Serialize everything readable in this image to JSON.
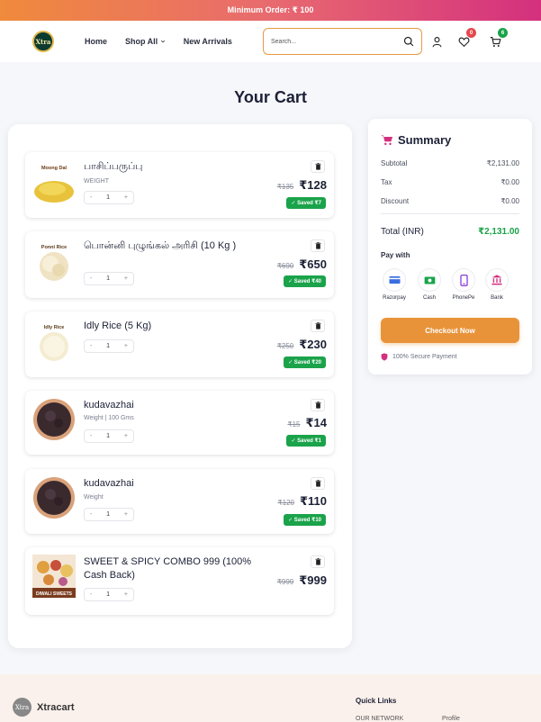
{
  "promo": {
    "text": "Minimum Order: ₹ 100"
  },
  "header": {
    "logo_text": "Xtra",
    "nav": [
      "Home",
      "Shop All",
      "New Arrivals"
    ],
    "search_placeholder": "Search...",
    "wishlist_count": "0",
    "cart_count": "6"
  },
  "page_title": "Your Cart",
  "cart": {
    "items": [
      {
        "name": "பாசிப்பருப்பு",
        "sub": "WEIGHT",
        "qty": "1",
        "old_price": "₹135",
        "price": "₹128",
        "saved": "Saved ₹7",
        "thumb_label": "Moong Dal"
      },
      {
        "name": "பொன்னி புழுங்கல் அரிசி (10 Kg )",
        "sub": "",
        "qty": "1",
        "old_price": "₹690",
        "price": "₹650",
        "saved": "Saved ₹40",
        "thumb_label": "Ponni Rice"
      },
      {
        "name": "Idly Rice (5 Kg)",
        "sub": "",
        "qty": "1",
        "old_price": "₹250",
        "price": "₹230",
        "saved": "Saved ₹20",
        "thumb_label": "Idly Rice"
      },
      {
        "name": "kudavazhai",
        "sub": "Weight | 100 Gms",
        "qty": "1",
        "old_price": "₹15",
        "price": "₹14",
        "saved": "Saved ₹1",
        "thumb_label": ""
      },
      {
        "name": "kudavazhai",
        "sub": "Weight",
        "qty": "1",
        "old_price": "₹120",
        "price": "₹110",
        "saved": "Saved ₹10",
        "thumb_label": ""
      },
      {
        "name": "SWEET & SPICY COMBO 999 (100% Cash Back)",
        "sub": "",
        "qty": "1",
        "old_price": "₹999",
        "price": "₹999",
        "saved": "",
        "thumb_label": "DIWALI SWEETS"
      }
    ],
    "qty_minus": "-",
    "qty_plus": "+"
  },
  "summary": {
    "title": "Summary",
    "subtotal_label": "Subtotal",
    "subtotal": "₹2,131.00",
    "tax_label": "Tax",
    "tax": "₹0.00",
    "discount_label": "Discount",
    "discount": "₹0.00",
    "total_label": "Total (INR)",
    "total": "₹2,131.00",
    "pay_with": "Pay with",
    "methods": [
      "Razorpay",
      "Cash",
      "PhonePe",
      "Bank"
    ],
    "checkout": "Checkout Now",
    "secure": "100% Secure Payment"
  },
  "footer": {
    "logo_text": "Xtra",
    "brand": "Xtracart",
    "quick_links": "Quick Links",
    "links": [
      "OUR NETWORK",
      "Profile"
    ]
  },
  "colors": {
    "accent": "#e8933a",
    "saved_green": "#1aa34a",
    "brand_pink": "#d4307e"
  }
}
